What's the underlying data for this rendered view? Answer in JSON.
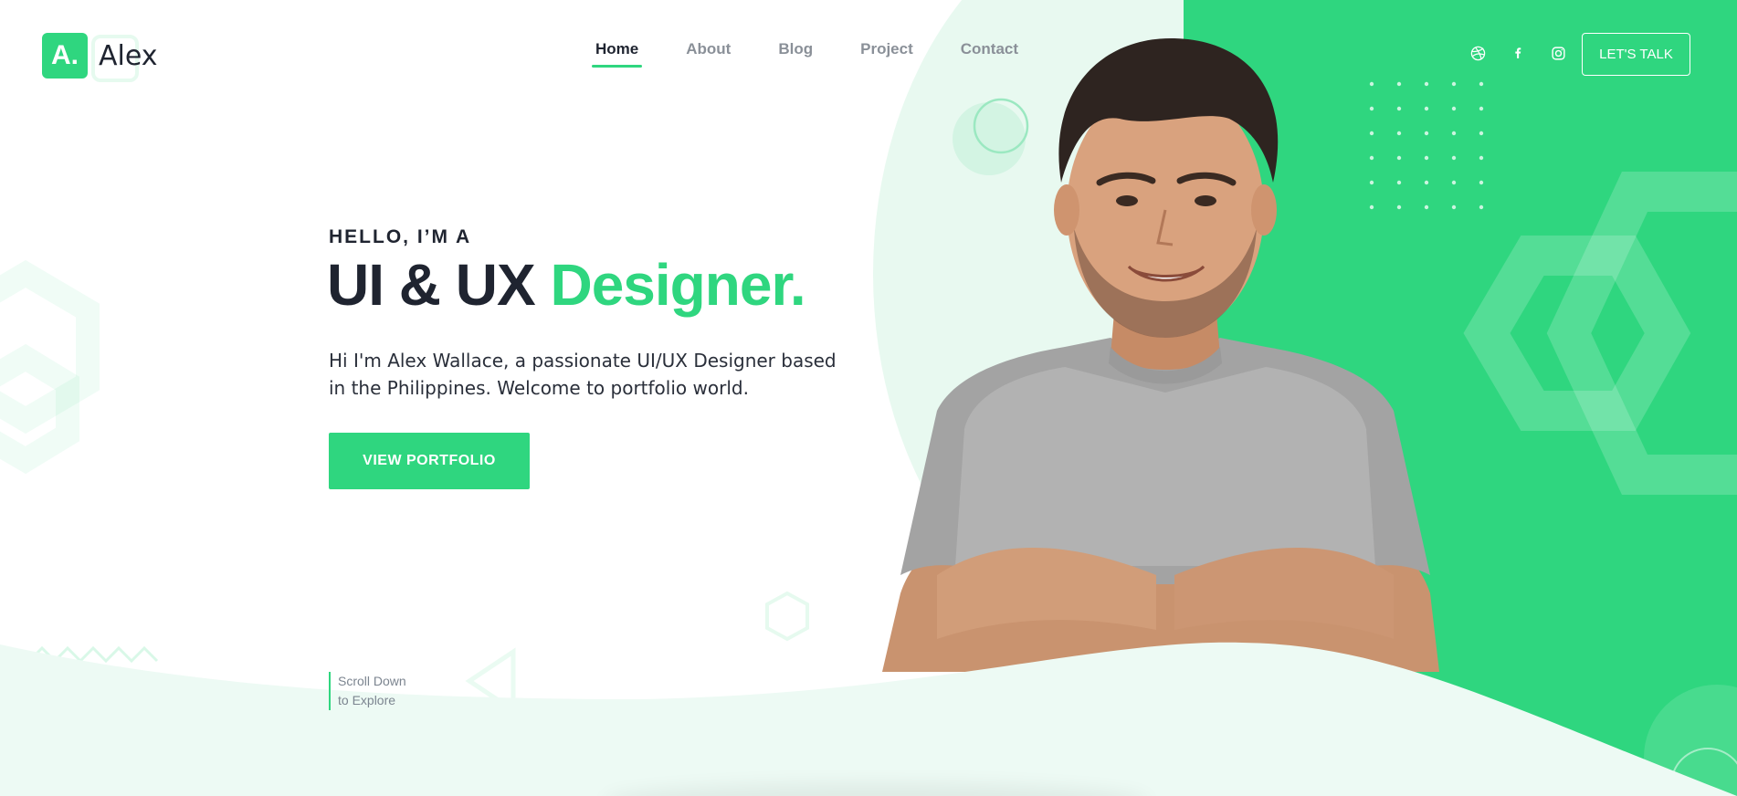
{
  "brand": {
    "badge": "A.",
    "name": "Alex"
  },
  "nav": {
    "items": [
      {
        "label": "Home",
        "active": true
      },
      {
        "label": "About",
        "active": false
      },
      {
        "label": "Blog",
        "active": false
      },
      {
        "label": "Project",
        "active": false
      },
      {
        "label": "Contact",
        "active": false
      }
    ]
  },
  "socials": [
    {
      "name": "dribbble-icon"
    },
    {
      "name": "facebook-icon"
    },
    {
      "name": "instagram-icon"
    }
  ],
  "cta": {
    "label": "LET'S TALK"
  },
  "hero": {
    "eyebrow": "HELLO, I’M A",
    "headline_main": "UI & UX ",
    "headline_accent": "Designer.",
    "description": "Hi I'm Alex Wallace, a passionate UI/UX Designer based in the Philippines. Welcome to portfolio world.",
    "button_label": "VIEW PORTFOLIO"
  },
  "scroll_hint": {
    "line1": "Scroll Down",
    "line2": "to Explore"
  },
  "colors": {
    "accent": "#2fd67f",
    "mint": "#e8f9f0",
    "dark": "#1f2430",
    "muted": "#8a9098"
  }
}
